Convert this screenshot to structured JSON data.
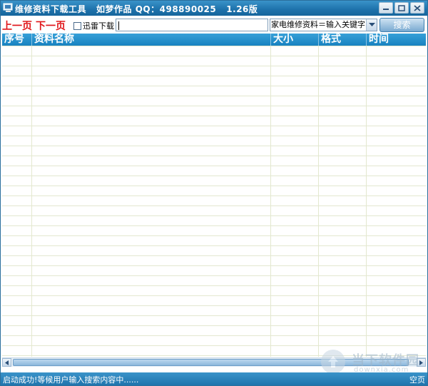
{
  "window": {
    "title": "维修资料下载工具   如梦作品 QQ：498890025   1.26版"
  },
  "toolbar": {
    "prev_page": "上一页",
    "next_page": "下一页",
    "thunder_checkbox_label": "迅雷下载",
    "thunder_checkbox_checked": false,
    "keyword_input_value": "",
    "category_select_value": "家电维修资料＝输入关键字",
    "search_button": "搜索"
  },
  "table": {
    "columns": [
      "序号",
      "资料名称",
      "大小",
      "格式",
      "时间"
    ],
    "rows": []
  },
  "statusbar": {
    "message": "启动成功!等候用户输入搜索内容中......",
    "right_text": "空页"
  },
  "watermark": {
    "name": "当下软件园",
    "url": "downxia.com"
  },
  "colors": {
    "title_bar": "#1f74ad",
    "header_bar": "#1882c0",
    "nav_link": "#e0161a",
    "grid_line": "#e3e8cf"
  }
}
